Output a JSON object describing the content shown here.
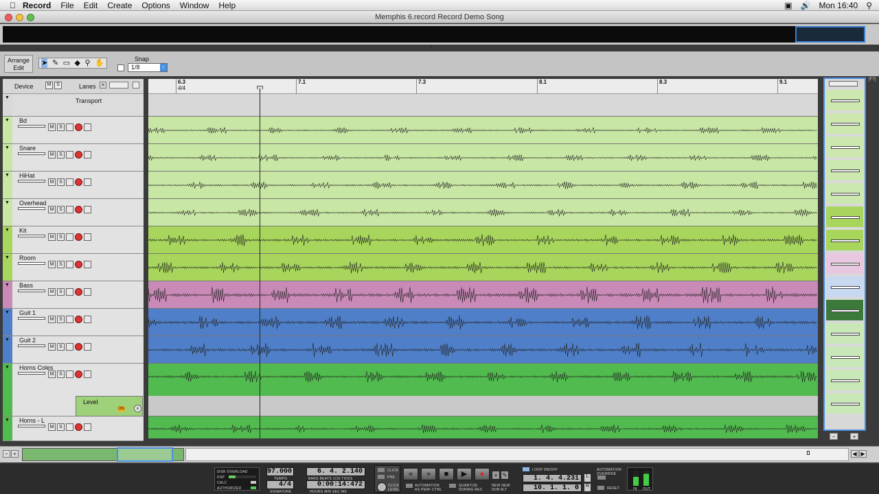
{
  "menubar": {
    "apple": "",
    "app": "Record",
    "items": [
      "File",
      "Edit",
      "Create",
      "Options",
      "Window",
      "Help"
    ],
    "clock": "Mon 16:40"
  },
  "window": {
    "title": "Memphis 6.record Record Demo Song"
  },
  "toolbar": {
    "arrange": "Arrange",
    "edit": "Edit",
    "snap_label": "Snap",
    "snap_value": "1/8"
  },
  "header": {
    "device": "Device",
    "m": "M",
    "s": "S",
    "lanes": "Lanes"
  },
  "ruler": {
    "bars": [
      "6.3",
      "7.1",
      "7.3",
      "8.1",
      "8.3",
      "9.1"
    ],
    "sig": "4/4"
  },
  "tracks": [
    {
      "name": "Transport",
      "color": "#d8d8d8"
    },
    {
      "name": "Bd",
      "color": "#c8e6a4"
    },
    {
      "name": "Snare",
      "color": "#c8e6a4"
    },
    {
      "name": "HiHat",
      "color": "#c8e6a4"
    },
    {
      "name": "Overhead",
      "color": "#c8e6a4"
    },
    {
      "name": "Kit",
      "color": "#a8d65c"
    },
    {
      "name": "Room",
      "color": "#a8d65c"
    },
    {
      "name": "Bass",
      "color": "#c98ab8"
    },
    {
      "name": "Guit 1",
      "color": "#4f7fc8"
    },
    {
      "name": "Guit 2",
      "color": "#4f7fc8"
    },
    {
      "name": "Horns Coles",
      "color": "#52bb4f"
    },
    {
      "name": "Horns - L",
      "color": "#52bb4f"
    }
  ],
  "automation": {
    "label": "Level",
    "on": "ON"
  },
  "transport": {
    "disk_overload": "DISK OVERLOAD",
    "dsp": "DSP",
    "calc": "CALC",
    "authorized": "AUTHORIZED",
    "tempo": "97.000",
    "tempo_label": "TEMPO",
    "signature": "4/4",
    "signature_label": "SIGNATURE",
    "position": "6.  4.  2.140",
    "position_label": "BARS  BEATS  1/16  TICKS",
    "time": "0:00:14:472",
    "time_label": "HOURS  MIN  SEC  MS",
    "click": "CLICK",
    "pre": "PRE",
    "click_level": "CLICK LEVEL",
    "automation_perf": "AUTOMATION AS PERF CTRL",
    "quantize": "QUANTIZE DURING REC",
    "new_dub": "NEW NEW DUB ALT",
    "loop_onoff": "LOOP ON/OFF",
    "loop_left": "1.  4.  4.231",
    "loop_right": "10.  1.  1.    0",
    "l": "L",
    "r": "R",
    "auto_override": "AUTOMATION OVERRIDE",
    "reset": "RESET",
    "in": "IN",
    "out": "OUT"
  }
}
